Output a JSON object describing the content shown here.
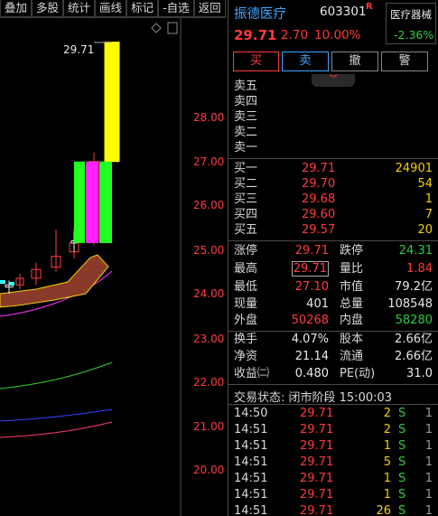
{
  "toolbar": {
    "items": [
      "叠加",
      "多股",
      "统计",
      "画线",
      "标记",
      "-自选",
      "返回"
    ]
  },
  "chart": {
    "peak_label": "29.71",
    "y_ticks": [
      "28.00",
      "27.00",
      "26.00",
      "25.00",
      "24.00",
      "23.00",
      "22.00",
      "21.00",
      "20.00"
    ]
  },
  "chart_data": {
    "type": "candlestick",
    "ylim": [
      19.5,
      29.9
    ],
    "y_ticks": [
      28,
      27,
      26,
      25,
      24,
      23,
      22,
      21,
      20
    ],
    "candles": [
      {
        "open": 24.15,
        "high": 24.3,
        "low": 24.0,
        "close": 24.2,
        "color": "white"
      },
      {
        "open": 24.2,
        "high": 24.45,
        "low": 24.1,
        "close": 24.35,
        "color": "red"
      },
      {
        "open": 24.35,
        "high": 24.7,
        "low": 24.2,
        "close": 24.55,
        "color": "red"
      },
      {
        "open": 24.6,
        "high": 25.45,
        "low": 24.5,
        "close": 24.85,
        "color": "red"
      },
      {
        "open": 24.95,
        "high": 25.5,
        "low": 24.8,
        "close": 25.15,
        "color": "red"
      },
      {
        "open": 25.15,
        "high": 25.4,
        "low": 24.95,
        "close": 25.2,
        "color": "white"
      },
      {
        "open": 25.2,
        "high": 27.2,
        "low": 25.1,
        "close": 27.0,
        "color": "red"
      },
      {
        "open": 27.0,
        "high": 29.71,
        "low": 27.0,
        "close": 29.71,
        "color": "yellow"
      }
    ],
    "highlight_bars": [
      {
        "bottom": 25.15,
        "top": 27.0,
        "color": "green"
      },
      {
        "bottom": 25.15,
        "top": 27.0,
        "color": "magenta"
      },
      {
        "bottom": 25.15,
        "top": 27.0,
        "color": "green"
      }
    ]
  },
  "header": {
    "name": "振德医疗",
    "code": "603301",
    "flag": "R",
    "price": "29.71",
    "change": "2.70",
    "change_pct": "10.00%",
    "sector_name": "医疗器械",
    "sector_change": "-2.36%"
  },
  "trade_buttons": [
    "买",
    "卖",
    "撤",
    "警"
  ],
  "asks": [
    {
      "label": "卖五",
      "price": "",
      "vol": ""
    },
    {
      "label": "卖四",
      "price": "",
      "vol": ""
    },
    {
      "label": "卖三",
      "price": "",
      "vol": ""
    },
    {
      "label": "卖二",
      "price": "",
      "vol": ""
    },
    {
      "label": "卖一",
      "price": "",
      "vol": ""
    }
  ],
  "bids": [
    {
      "label": "买一",
      "price": "29.71",
      "vol": "24901"
    },
    {
      "label": "买二",
      "price": "29.70",
      "vol": "54"
    },
    {
      "label": "买三",
      "price": "29.68",
      "vol": "1"
    },
    {
      "label": "买四",
      "price": "29.60",
      "vol": "7"
    },
    {
      "label": "买五",
      "price": "29.57",
      "vol": "20"
    }
  ],
  "stats1": [
    {
      "k1": "涨停",
      "v1": "29.71",
      "c1": "red",
      "k2": "跌停",
      "v2": "24.31",
      "c2": "green"
    },
    {
      "k1": "最高",
      "v1": "29.71",
      "c1": "red",
      "k2": "量比",
      "v2": "1.84",
      "c2": "red",
      "boxed": true
    },
    {
      "k1": "最低",
      "v1": "27.10",
      "c1": "red",
      "k2": "市值",
      "v2": "79.2亿",
      "c2": "white"
    },
    {
      "k1": "现量",
      "v1": "401",
      "c1": "white",
      "k2": "总量",
      "v2": "108548",
      "c2": "white"
    },
    {
      "k1": "外盘",
      "v1": "50268",
      "c1": "red",
      "k2": "内盘",
      "v2": "58280",
      "c2": "green"
    }
  ],
  "stats2": [
    {
      "k1": "换手",
      "v1": "4.07%",
      "c1": "white",
      "k2": "股本",
      "v2": "2.66亿",
      "c2": "white"
    },
    {
      "k1": "净资",
      "v1": "21.14",
      "c1": "white",
      "k2": "流通",
      "v2": "2.66亿",
      "c2": "white"
    },
    {
      "k1": "收益㈡",
      "v1": "0.480",
      "c1": "white",
      "k2": "PE(动)",
      "v2": "31.0",
      "c2": "white"
    }
  ],
  "status": "交易状态: 闭市阶段 15:00:03",
  "ticks": [
    {
      "time": "14:50",
      "price": "29.71",
      "vol": "2",
      "side": "S",
      "num": "1"
    },
    {
      "time": "14:51",
      "price": "29.71",
      "vol": "2",
      "side": "S",
      "num": "1"
    },
    {
      "time": "14:51",
      "price": "29.71",
      "vol": "1",
      "side": "S",
      "num": "1"
    },
    {
      "time": "14:51",
      "price": "29.71",
      "vol": "5",
      "side": "S",
      "num": "1"
    },
    {
      "time": "14:51",
      "price": "29.71",
      "vol": "1",
      "side": "S",
      "num": "1"
    },
    {
      "time": "14:51",
      "price": "29.71",
      "vol": "1",
      "side": "S",
      "num": "1"
    },
    {
      "time": "14:51",
      "price": "29.71",
      "vol": "26",
      "side": "S",
      "num": "1"
    }
  ],
  "colors": {
    "up": "#ff3b3b",
    "down": "#2ecc40",
    "accent": "#3fa6ff",
    "volume": "#f2d100"
  }
}
